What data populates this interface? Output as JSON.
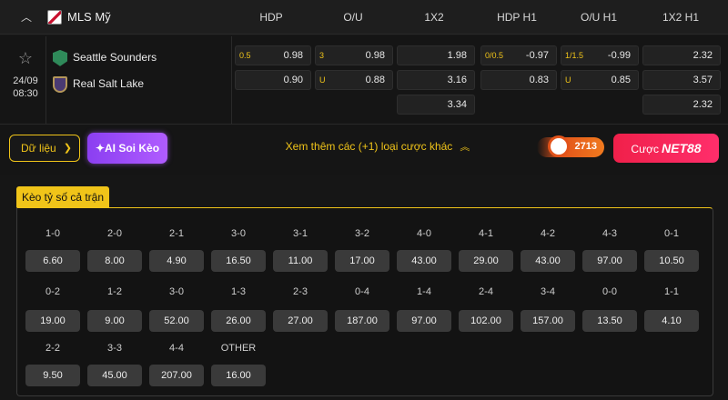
{
  "header": {
    "league": "MLS Mỹ",
    "columns": [
      "HDP",
      "O/U",
      "1X2",
      "HDP H1",
      "O/U H1",
      "1X2 H1"
    ]
  },
  "match": {
    "date": "24/09",
    "time": "08:30",
    "home": "Seattle Sounders",
    "away": "Real Salt Lake",
    "hdp": {
      "line": "0.5",
      "home": "0.98",
      "away": "0.90"
    },
    "ou": {
      "line": "3",
      "over": "0.98",
      "under_label": "U",
      "under": "0.88"
    },
    "x12": {
      "home": "1.98",
      "away": "3.16",
      "draw": "3.34"
    },
    "hdp_h1": {
      "line": "0/0.5",
      "home": "-0.97",
      "away": "0.83"
    },
    "ou_h1": {
      "line": "1/1.5",
      "over": "-0.99",
      "under_label": "U",
      "under": "0.85"
    },
    "x12_h1": {
      "home": "2.32",
      "away": "3.57",
      "draw": "2.32"
    }
  },
  "actions": {
    "data_label": "Dữ liệu",
    "ai_label": "AI Soi Kèo",
    "more_label": "Xem thêm các (+1) loại cược khác",
    "badge_count": "2713",
    "bet_label": "Cược",
    "bet_brand": "NET88"
  },
  "correct_score": {
    "tab_label": "Kèo tỷ số cả trận",
    "items": [
      {
        "score": "1-0",
        "odd": "6.60"
      },
      {
        "score": "2-0",
        "odd": "8.00"
      },
      {
        "score": "2-1",
        "odd": "4.90"
      },
      {
        "score": "3-0",
        "odd": "16.50"
      },
      {
        "score": "3-1",
        "odd": "11.00"
      },
      {
        "score": "3-2",
        "odd": "17.00"
      },
      {
        "score": "4-0",
        "odd": "43.00"
      },
      {
        "score": "4-1",
        "odd": "29.00"
      },
      {
        "score": "4-2",
        "odd": "43.00"
      },
      {
        "score": "4-3",
        "odd": "97.00"
      },
      {
        "score": "0-1",
        "odd": "10.50"
      },
      {
        "score": "0-2",
        "odd": "19.00"
      },
      {
        "score": "1-2",
        "odd": "9.00"
      },
      {
        "score": "3-0",
        "odd": "52.00"
      },
      {
        "score": "1-3",
        "odd": "26.00"
      },
      {
        "score": "2-3",
        "odd": "27.00"
      },
      {
        "score": "0-4",
        "odd": "187.00"
      },
      {
        "score": "1-4",
        "odd": "97.00"
      },
      {
        "score": "2-4",
        "odd": "102.00"
      },
      {
        "score": "3-4",
        "odd": "157.00"
      },
      {
        "score": "0-0",
        "odd": "13.50"
      },
      {
        "score": "1-1",
        "odd": "4.10"
      },
      {
        "score": "2-2",
        "odd": "9.50"
      },
      {
        "score": "3-3",
        "odd": "45.00"
      },
      {
        "score": "4-4",
        "odd": "207.00"
      },
      {
        "score": "OTHER",
        "odd": "16.00"
      }
    ]
  },
  "colors": {
    "accent": "#f0c419",
    "ai": "#9b4cf5",
    "bet": "#f0204a"
  }
}
